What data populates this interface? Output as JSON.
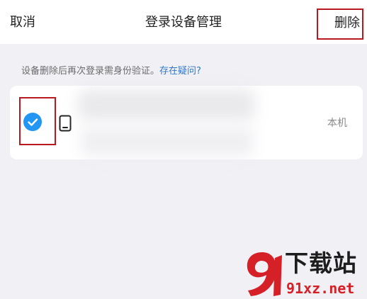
{
  "header": {
    "cancel_label": "取消",
    "title": "登录设备管理",
    "delete_label": "删除"
  },
  "notice": {
    "text": "设备删除后再次登录需身份验证。",
    "link": "存在疑问?"
  },
  "device": {
    "selected": true,
    "tag": "本机",
    "icon": "phone-icon"
  },
  "watermark": {
    "text": "下载站",
    "site": "91xz.net"
  },
  "colors": {
    "accent": "#2196f3",
    "link": "#2f77c8",
    "highlight_box": "#b8191f",
    "background": "#f1f0f5"
  }
}
